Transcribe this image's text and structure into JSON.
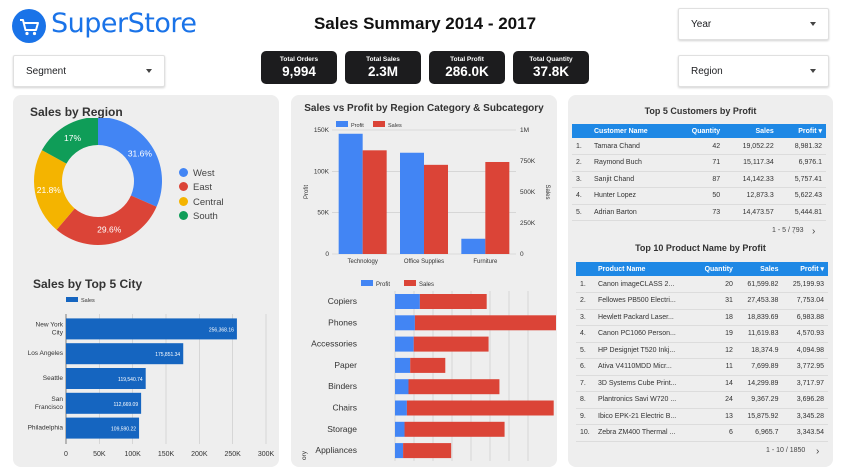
{
  "brand": {
    "name": "SuperStore",
    "logo_icon": "shopping-cart-icon"
  },
  "title": "Sales Summary 2014 - 2017",
  "filters": {
    "year": "Year",
    "segment": "Segment",
    "region": "Region"
  },
  "kpis": [
    {
      "label": "Total Orders",
      "value": "9,994"
    },
    {
      "label": "Total Sales",
      "value": "2.3M"
    },
    {
      "label": "Total Profit",
      "value": "286.0K"
    },
    {
      "label": "Total Quantity",
      "value": "37.8K"
    }
  ],
  "colors": {
    "accent": "#1a73e8",
    "blue": "#4285f4",
    "red": "#db4437",
    "yellow": "#f4b400",
    "green": "#0f9d58",
    "bar_dark_blue": "#1565c0",
    "table_header": "#1e88e5"
  },
  "sales_by_region": {
    "title": "Sales by Region",
    "chart_data": {
      "type": "pie",
      "labels": [
        "West",
        "East",
        "Central",
        "South"
      ],
      "values": [
        31.6,
        29.6,
        21.8,
        17
      ],
      "value_labels": [
        "31.6%",
        "29.6%",
        "21.8%",
        "17%"
      ],
      "colors": [
        "#4285f4",
        "#db4437",
        "#f4b400",
        "#0f9d58"
      ],
      "legend": "right"
    }
  },
  "sales_by_city": {
    "title": "Sales by Top 5 City",
    "chart_data": {
      "type": "bar",
      "orientation": "horizontal",
      "categories": [
        [
          "New York",
          "City"
        ],
        [
          "Los Angeles"
        ],
        [
          "Seattle"
        ],
        [
          "San",
          "Francisco"
        ],
        [
          "Philadelphia"
        ]
      ],
      "series": [
        {
          "name": "Sales",
          "values": [
            256368.16,
            175851.34,
            119540.74,
            112669.09,
            109590.22
          ]
        }
      ],
      "value_labels": [
        "256,368.16",
        "175,851.34",
        "119,540.74",
        "112,669.09",
        "109,590.22"
      ],
      "xlim": [
        0,
        300000
      ],
      "xticks": [
        "0",
        "50K",
        "100K",
        "150K",
        "200K",
        "250K",
        "300K"
      ],
      "legend": "top-left"
    }
  },
  "profit_by_category": {
    "title": "Sales vs Profit by Region Category & Subcategory",
    "chart_data": {
      "type": "bar",
      "categories": [
        "Technology",
        "Office Supplies",
        "Furniture"
      ],
      "series": [
        {
          "name": "Profit",
          "values": [
            145455,
            122491,
            18451
          ],
          "axis": "left"
        },
        {
          "name": "Sales",
          "values": [
            836154,
            719047,
            742000
          ],
          "axis": "right"
        }
      ],
      "ylabel": "Profit",
      "y2label": "Sales",
      "yticks": [
        "0",
        "50K",
        "100K",
        "150K"
      ],
      "y2ticks": [
        "0",
        "250K",
        "500K",
        "750K",
        "1M"
      ],
      "ylim": [
        0,
        150000
      ],
      "y2lim": [
        0,
        1000000
      ],
      "legend": "top-left"
    }
  },
  "subcategory_chart": {
    "chart_data": {
      "type": "bar",
      "orientation": "horizontal",
      "categories": [
        "Copiers",
        "Phones",
        "Accessories",
        "Paper",
        "Binders",
        "Chairs",
        "Storage",
        "Appliances"
      ],
      "series": [
        {
          "name": "Profit",
          "values": [
            55600,
            44500,
            41900,
            34000,
            30200,
            26600,
            21300,
            18100
          ]
        },
        {
          "name": "Sales",
          "values": [
            149500,
            330000,
            167400,
            78500,
            203400,
            328400,
            223800,
            107500
          ]
        }
      ],
      "ylabel": "Category",
      "legend": "top"
    }
  },
  "top_customers": {
    "title": "Top 5 Customers by Profit",
    "columns": [
      "Customer Name",
      "Quantity",
      "Sales",
      "Profit"
    ],
    "rows": [
      [
        "1.",
        "Tamara Chand",
        "42",
        "19,052.22",
        "8,981.32"
      ],
      [
        "2.",
        "Raymond Buch",
        "71",
        "15,117.34",
        "6,976.1"
      ],
      [
        "3.",
        "Sanjit Chand",
        "87",
        "14,142.33",
        "5,757.41"
      ],
      [
        "4.",
        "Hunter Lopez",
        "50",
        "12,873.3",
        "5,622.43"
      ],
      [
        "5.",
        "Adrian Barton",
        "73",
        "14,473.57",
        "5,444.81"
      ]
    ],
    "pager": "1 - 5 / 793"
  },
  "top_products": {
    "title": "Top 10 Product Name by Profit",
    "columns": [
      "Product Name",
      "Quantity",
      "Sales",
      "Profit"
    ],
    "rows": [
      [
        "1.",
        "Canon imageCLASS 2...",
        "20",
        "61,599.82",
        "25,199.93"
      ],
      [
        "2.",
        "Fellowes PB500 Electri...",
        "31",
        "27,453.38",
        "7,753.04"
      ],
      [
        "3.",
        "Hewlett Packard Laser...",
        "18",
        "18,839.69",
        "6,983.88"
      ],
      [
        "4.",
        "Canon PC1060 Person...",
        "19",
        "11,619.83",
        "4,570.93"
      ],
      [
        "5.",
        "HP Designjet T520 Inkj...",
        "12",
        "18,374.9",
        "4,094.98"
      ],
      [
        "6.",
        "Ativa V4110MDD Micr...",
        "11",
        "7,699.89",
        "3,772.95"
      ],
      [
        "7.",
        "3D Systems Cube Print...",
        "14",
        "14,299.89",
        "3,717.97"
      ],
      [
        "8.",
        "Plantronics Savi W720 ...",
        "24",
        "9,367.29",
        "3,696.28"
      ],
      [
        "9.",
        "Ibico EPK-21 Electric B...",
        "13",
        "15,875.92",
        "3,345.28"
      ],
      [
        "10.",
        "Zebra ZM400 Thermal ...",
        "6",
        "6,965.7",
        "3,343.54"
      ]
    ],
    "pager": "1 - 10 / 1850"
  }
}
